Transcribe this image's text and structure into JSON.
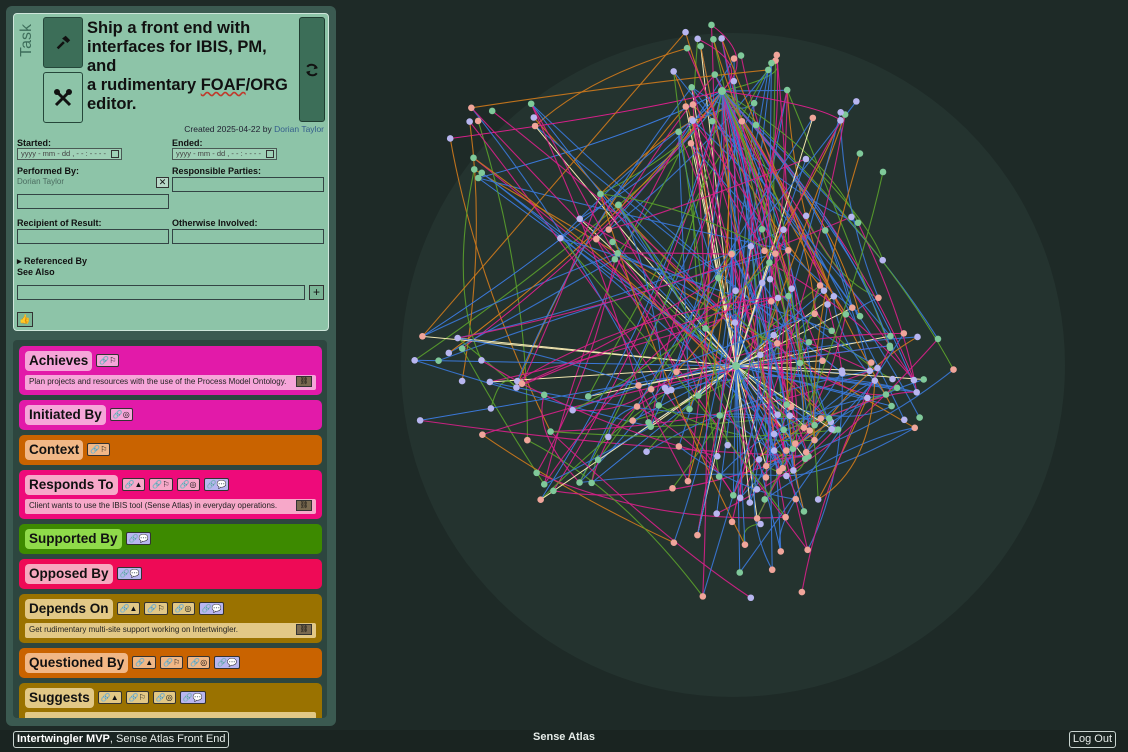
{
  "task": {
    "vertical_label": "Task",
    "title_line1": "Ship a front end with",
    "title_line2": "interfaces for IBIS, PM, and",
    "title_line3_pre": "a rudimentary ",
    "title_line3_squig": "FOAF",
    "title_line3_post": "/ORG",
    "title_line4": "editor.",
    "created_prefix": "Created 2025-04-22 by ",
    "created_by": "Dorian Taylor",
    "started_label": "Started:",
    "ended_label": "Ended:",
    "date_placeholder": "yyyy - mm - dd ,  - - : - -    - -",
    "performed_by_label": "Performed By:",
    "performed_by_value": "Dorian Taylor",
    "responsible_label": "Responsible Parties:",
    "recipient_label": "Recipient of Result:",
    "otherwise_label": "Otherwise Involved:",
    "referenced_by_label": "Referenced By",
    "see_also_label": "See Also",
    "remove_glyph": "✕",
    "add_glyph": "+",
    "thumb_glyph": "👍"
  },
  "relations": [
    {
      "name": "Achieves",
      "color": "#e21aa9",
      "label_bg": "#f6a5d9",
      "chips": [
        "🔗⚐"
      ],
      "items": [
        "Plan projects and resources with the use of the Process Model Ontology."
      ]
    },
    {
      "name": "Initiated By",
      "color": "#e21aa9",
      "label_bg": "#f6a5d9",
      "chips": [
        "🔗◎"
      ],
      "items": []
    },
    {
      "name": "Context",
      "color": "#c96300",
      "label_bg": "#f1b786",
      "chips": [
        "🔗⚐"
      ],
      "items": []
    },
    {
      "name": "Responds To",
      "color": "#ee0a7a",
      "label_bg": "#f7a8c9",
      "chips": [
        "🔗▲",
        "🔗⚐",
        "🔗◎",
        "🔗💬"
      ],
      "items": [
        "Client wants to use the IBIS tool (Sense Atlas) in everyday operations."
      ]
    },
    {
      "name": "Supported By",
      "color": "#3d8a00",
      "label_bg": "#8fdb4a",
      "chips": [
        "🔗💬"
      ],
      "items": []
    },
    {
      "name": "Opposed By",
      "color": "#ee0a56",
      "label_bg": "#f7a8bf",
      "chips": [
        "🔗💬"
      ],
      "items": []
    },
    {
      "name": "Depends On",
      "color": "#9a7200",
      "label_bg": "#e2c886",
      "chips": [
        "🔗▲",
        "🔗⚐",
        "🔗◎",
        "🔗💬"
      ],
      "items": [
        "Get rudimentary multi-site support working on Intertwingler."
      ]
    },
    {
      "name": "Questioned By",
      "color": "#c96300",
      "label_bg": "#f1b786",
      "chips": [
        "🔗▲",
        "🔗⚐",
        "🔗◎",
        "🔗💬"
      ],
      "items": []
    },
    {
      "name": "Suggests",
      "color": "#9a7200",
      "label_bg": "#e2c886",
      "chips": [
        "🔗▲",
        "🔗⚐",
        "🔗◎",
        "🔗💬"
      ],
      "items": [
        ""
      ]
    }
  ],
  "status": {
    "site_bold": "Intertwingler MVP",
    "site_rest": ", Sense Atlas Front End",
    "center": "Sense Atlas",
    "logout": "Log Out"
  },
  "colors": {
    "edge_blue": "#3a78d8",
    "edge_orange": "#d07a1c",
    "edge_magenta": "#d8208a",
    "edge_green": "#5aa02c",
    "edge_cream": "#f3e7b0",
    "node_green": "#7fc99a",
    "node_pink": "#f0a59a",
    "node_lavender": "#b8b6f0"
  }
}
